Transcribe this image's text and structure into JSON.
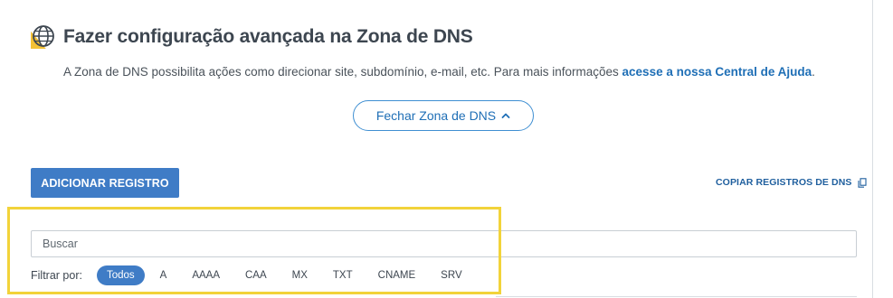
{
  "header": {
    "title": "Fazer configuração avançada na Zona de DNS",
    "icon": "globe-icon"
  },
  "description": {
    "text": "A Zona de DNS possibilita ações como direcionar site, subdomínio, e-mail, etc. Para mais informações ",
    "link_text": "acesse a nossa Central de Ajuda",
    "suffix": "."
  },
  "close_zone_button": {
    "label": "Fechar Zona de DNS",
    "icon": "chevron-up-icon"
  },
  "add_record_button": {
    "label": "ADICIONAR REGISTRO"
  },
  "copy_records_link": {
    "label": "COPIAR REGISTROS DE DNS",
    "icon": "copy-icon"
  },
  "search": {
    "placeholder": "Buscar",
    "value": ""
  },
  "filter": {
    "label": "Filtrar por:",
    "options": [
      "Todos",
      "A",
      "AAAA",
      "CAA",
      "MX",
      "TXT",
      "CNAME",
      "SRV"
    ],
    "selected": "Todos"
  },
  "colors": {
    "accent_blue": "#3f7cc6",
    "link_blue": "#1f6fb6",
    "highlight_yellow": "#f2d33a",
    "globe_accent": "#f3c135"
  }
}
